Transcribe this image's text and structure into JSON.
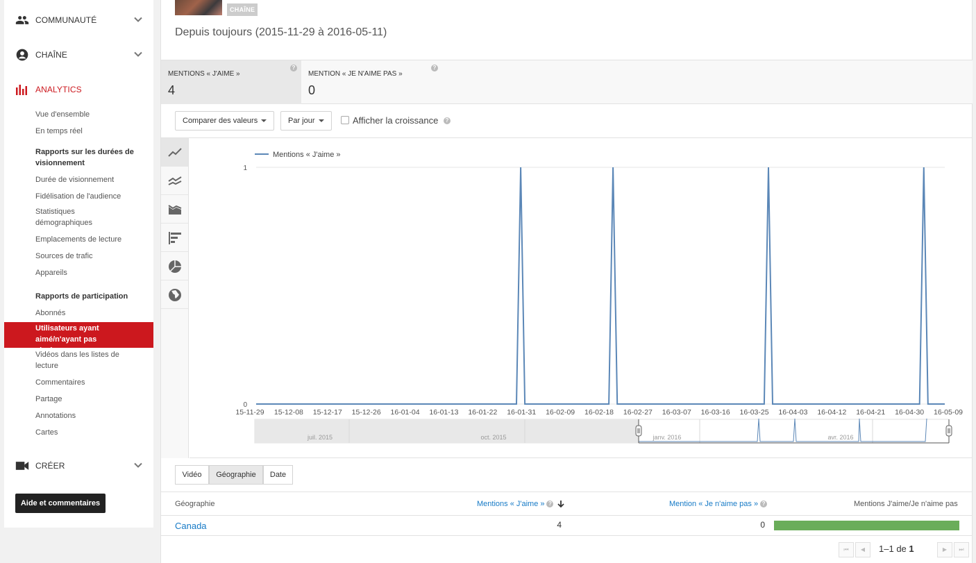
{
  "sidebar": {
    "sections": [
      {
        "label": "COMMUNAUTÉ",
        "icon": "people-icon"
      },
      {
        "label": "CHAÎNE",
        "icon": "account-circle-icon"
      },
      {
        "label": "ANALYTICS",
        "icon": "bar-chart-icon"
      }
    ],
    "analytics_items": {
      "overview": "Vue d'ensemble",
      "realtime": "En temps réel",
      "watch_head": "Rapports sur les durées de visionnement",
      "watch_time": "Durée de visionnement",
      "retention": "Fidélisation de l'audience",
      "demographics": "Statistiques démographiques",
      "playback": "Emplacements de lecture",
      "traffic": "Sources de trafic",
      "devices": "Appareils",
      "engagement_head": "Rapports de participation",
      "subscribers": "Abonnés",
      "likes": "Utilisateurs ayant aimé/n'ayant pas aimé",
      "playlists": "Vidéos dans les listes de lecture",
      "comments": "Commentaires",
      "sharing": "Partage",
      "annotations": "Annotations",
      "cards": "Cartes"
    },
    "create": {
      "label": "CRÉER"
    },
    "help_button": "Aide et commentaires"
  },
  "header": {
    "channel_badge": "CHAÎNE",
    "date_range": "Depuis toujours (2015-11-29 à 2016-05-11)"
  },
  "metrics": {
    "likes": {
      "label": "MENTIONS « J'AIME »",
      "value": "4"
    },
    "dislikes": {
      "label": "MENTION « JE N'AIME PAS »",
      "value": "0"
    }
  },
  "controls": {
    "compare": "Comparer des valeurs",
    "period": "Par jour",
    "growth": "Afficher la croissance"
  },
  "chart_data": {
    "type": "line",
    "series": [
      {
        "name": "Mentions « J'aime »",
        "color": "#5b87b7"
      }
    ],
    "x_ticks": [
      "15-11-29",
      "15-12-08",
      "15-12-17",
      "15-12-26",
      "16-01-04",
      "16-01-13",
      "16-01-22",
      "16-01-31",
      "16-02-09",
      "16-02-18",
      "16-02-27",
      "16-03-07",
      "16-03-16",
      "16-03-25",
      "16-04-03",
      "16-04-12",
      "16-04-21",
      "16-04-30",
      "16-05-09"
    ],
    "y_ticks": [
      "0",
      "1"
    ],
    "ylim": [
      0,
      1
    ],
    "xlim": [
      "2015-11-29",
      "2016-05-11"
    ],
    "points": [
      {
        "x": "2015-11-29",
        "y": 0
      },
      {
        "x": "2016-01-30",
        "y": 0
      },
      {
        "x": "2016-01-31",
        "y": 1
      },
      {
        "x": "2016-02-01",
        "y": 0
      },
      {
        "x": "2016-02-21",
        "y": 0
      },
      {
        "x": "2016-02-22",
        "y": 1
      },
      {
        "x": "2016-02-23",
        "y": 0
      },
      {
        "x": "2016-03-29",
        "y": 0
      },
      {
        "x": "2016-03-30",
        "y": 1
      },
      {
        "x": "2016-03-31",
        "y": 0
      },
      {
        "x": "2016-05-05",
        "y": 0
      },
      {
        "x": "2016-05-06",
        "y": 1
      },
      {
        "x": "2016-05-07",
        "y": 0
      },
      {
        "x": "2016-05-11",
        "y": 0
      }
    ],
    "navigator_labels": [
      "juil. 2015",
      "oct. 2015",
      "janv. 2016",
      "avr. 2016"
    ]
  },
  "tabs": [
    "Vidéo",
    "Géographie",
    "Date"
  ],
  "table": {
    "headers": {
      "geo": "Géographie",
      "likes": "Mentions « J'aime »",
      "dislikes": "Mention « Je n'aime pas »",
      "ratio": "Mentions J'aime/Je n'aime pas"
    },
    "rows": [
      {
        "country": "Canada",
        "likes": "4",
        "dislikes": "0",
        "like_share": 1.0
      }
    ]
  },
  "pagination": {
    "range": "1–1",
    "of": "de",
    "total": "1"
  },
  "colors": {
    "accent": "#cc181e",
    "link": "#167ac6",
    "bar": "#6aad5a",
    "series": "#5b87b7"
  }
}
